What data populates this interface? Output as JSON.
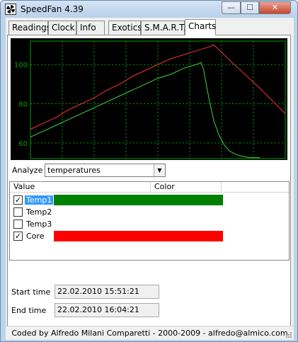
{
  "window": {
    "title": "SpeedFan 4.39",
    "controls": {
      "minimize": "—",
      "maximize": "☐",
      "close": "✕"
    }
  },
  "tabs": [
    "Readings",
    "Clock",
    "Info",
    "Exotics",
    "S.M.A.R.T.",
    "Charts"
  ],
  "active_tab": "Charts",
  "chart_data": {
    "type": "line",
    "y_ticks": [
      60,
      80,
      100
    ],
    "ylim": [
      52,
      112
    ],
    "xlim": [
      0,
      100
    ],
    "grid": true,
    "background": "#000000",
    "grid_color": "#00a000",
    "series": [
      {
        "name": "Temp1",
        "color": "#3fd43f",
        "x": [
          0,
          5,
          10,
          15,
          20,
          25,
          30,
          35,
          40,
          45,
          50,
          55,
          60,
          65,
          67,
          68,
          70,
          72,
          74,
          76,
          78,
          80,
          82,
          84,
          86,
          88,
          90
        ],
        "y": [
          63,
          66,
          69,
          72,
          75,
          78,
          81,
          84,
          87,
          90,
          93,
          95,
          98,
          100,
          101,
          97,
          83,
          71,
          64,
          59,
          56,
          54.5,
          53.5,
          53,
          52.5,
          52.5,
          52.5
        ]
      },
      {
        "name": "Core",
        "color": "#ff3030",
        "x": [
          0,
          5,
          10,
          15,
          20,
          25,
          30,
          35,
          40,
          45,
          50,
          55,
          60,
          65,
          70,
          72,
          80,
          90,
          100
        ],
        "y": [
          67,
          70,
          73,
          77,
          80,
          83,
          87,
          90,
          94,
          97,
          100,
          103,
          105,
          107,
          109,
          110,
          100,
          88,
          75
        ]
      }
    ]
  },
  "analyze": {
    "label": "Analyze",
    "value": "temperatures"
  },
  "list": {
    "columns": [
      "Value",
      "Color"
    ],
    "rows": [
      {
        "label": "Temp1",
        "checked": true,
        "color": "#008000",
        "selected": true
      },
      {
        "label": "Temp2",
        "checked": false,
        "color": ""
      },
      {
        "label": "Temp3",
        "checked": false,
        "color": ""
      },
      {
        "label": "Core",
        "checked": true,
        "color": "#ff0000"
      }
    ]
  },
  "start_time": {
    "label": "Start time",
    "value": "22.02.2010 15:51:21"
  },
  "end_time": {
    "label": "End time",
    "value": "22.02.2010 16:04:21"
  },
  "statusbar": "Coded by Alfredo Milani Comparetti - 2000-2009 - alfredo@almico.com"
}
